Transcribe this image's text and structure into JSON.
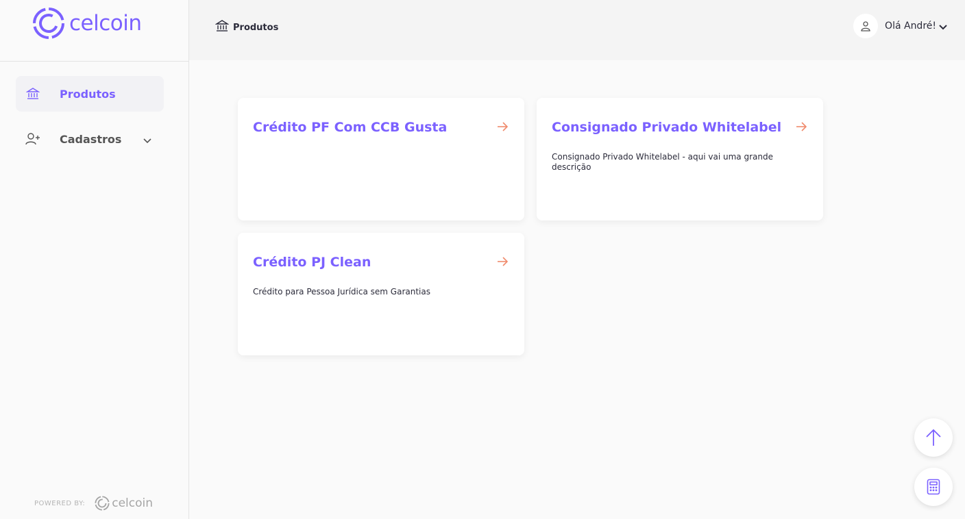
{
  "brand": {
    "name": "celcoin",
    "color": "#7b61ff"
  },
  "sidebar": {
    "items": [
      {
        "label": "Produtos",
        "icon": "bank-icon",
        "active": true
      },
      {
        "label": "Cadastros",
        "icon": "add-user-icon",
        "active": false
      }
    ],
    "powered_by": "POWERED BY:",
    "powered_logo": "celcoin"
  },
  "header": {
    "breadcrumb": "Produtos",
    "user_greeting": "Olá André!"
  },
  "cards": [
    {
      "title": "Crédito PF Com CCB Gusta",
      "description": ""
    },
    {
      "title": "Consignado Privado Whitelabel",
      "description": "Consignado Privado Whitelabel - aqui vai uma grande descrição"
    },
    {
      "title": "Crédito PJ Clean",
      "description": "Crédito para Pessoa Jurídica sem Garantias"
    }
  ],
  "colors": {
    "accent": "#7b61ff",
    "arrow": "#f08a6c"
  },
  "fabs": [
    "arrow-up-icon",
    "calculator-icon"
  ]
}
